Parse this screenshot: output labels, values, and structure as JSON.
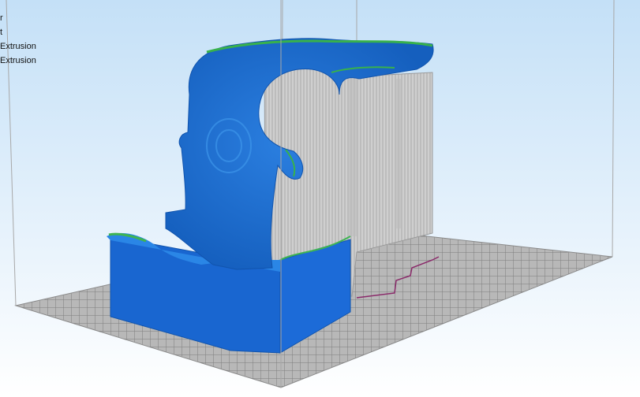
{
  "legend": {
    "items": [
      {
        "label": "r"
      },
      {
        "label": "t"
      },
      {
        "label": "Extrusion"
      },
      {
        "label": "Extrusion"
      }
    ]
  },
  "colors": {
    "background_top": "#cfe6fa",
    "background_bottom": "#ffffff",
    "bed": "#b5b5b5",
    "bed_grid": "#7c7c7c",
    "model": "#1f6fd6",
    "model_dark": "#1558b0",
    "highlight": "#39b54a",
    "support": "#c8c8c8",
    "travel_path": "#8a2a6a",
    "frame": "#a8a8a8"
  }
}
